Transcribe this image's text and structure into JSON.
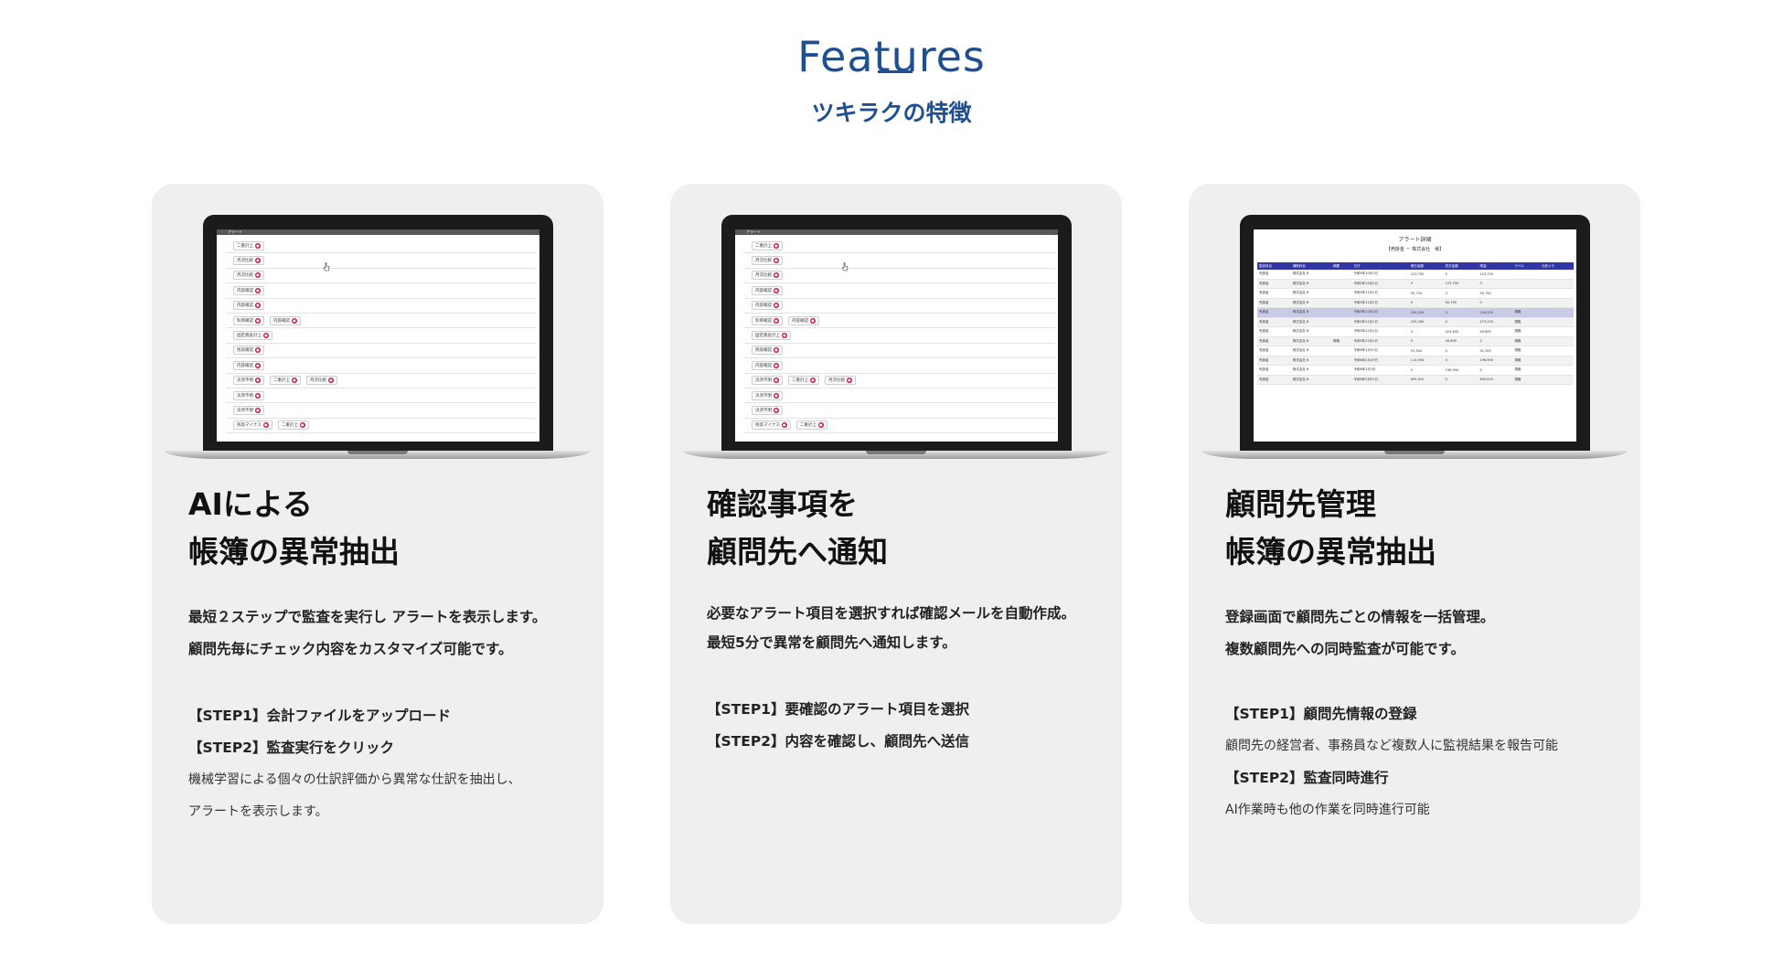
{
  "header": {
    "title": "Features",
    "subtitle": "ツキラクの特徴"
  },
  "cards": [
    {
      "heading_line1": "AIによる",
      "heading_line2": "帳簿の異常抽出",
      "desc_line1": "最短２ステップで監査を実行し アラートを表示します。",
      "desc_line2": "顧問先毎にチェック内容をカスタマイズ可能です。",
      "step1": "【STEP1】会計ファイルをアップロード",
      "step2": "【STEP2】監査実行をクリック",
      "note_line1": "機械学習による個々の仕訳評価から異常な仕訳を抽出し、",
      "note_line2": "アラートを表示します。"
    },
    {
      "heading_line1": "確認事項を",
      "heading_line2": "顧問先へ通知",
      "desc_line1": "必要なアラート項目を選択すれば確認メールを自動作成。",
      "desc_line2": "最短5分で異常を顧問先へ通知します。",
      "step1": "【STEP1】要確認のアラート項目を選択",
      "step2": "【STEP2】内容を確認し、顧問先へ送信"
    },
    {
      "heading_line1": "顧問先管理",
      "heading_line2": "帳簿の異常抽出",
      "desc_line1": "登録画面で顧問先ごとの情報を一括管理。",
      "desc_line2": "複数顧問先への同時監査が可能です。",
      "step1": "【STEP1】顧問先情報の登録",
      "note1": "顧問先の経営者、事務員など複数人に監視結果を報告可能",
      "step2": "【STEP2】監査同時進行",
      "note2": "AI作業時も他の作業を同時進行可能"
    }
  ],
  "screen_alerts": {
    "header_label": "アラート",
    "rows": [
      [
        "二重計上"
      ],
      [
        "月次比較"
      ],
      [
        "月次比較"
      ],
      [
        "内容確認"
      ],
      [
        "内容確認"
      ],
      [
        "科目確認",
        "内容確認"
      ],
      [
        "固定資産計上"
      ],
      [
        "残高確認"
      ],
      [
        "内容確認"
      ],
      [
        "決済不明",
        "二重計上",
        "月次比較"
      ],
      [
        "決済不明"
      ],
      [
        "決済不明"
      ],
      [
        "残高マイナス",
        "二重計上"
      ]
    ]
  },
  "screen_table": {
    "title": "アラート詳細",
    "subtitle": "【売掛金 ー 株式会社　様】",
    "columns": [
      "勘定科目",
      "補助科目",
      "摘要",
      "日付",
      "借方金額",
      "貸方金額",
      "残高",
      "ラベル",
      "仕訳メモ"
    ],
    "rows": [
      [
        "売掛金",
        "株式会社 B",
        "",
        "令和5年10月1日",
        "123,750",
        "0",
        "123,750",
        "",
        ""
      ],
      [
        "売掛金",
        "株式会社 B",
        "",
        "令和5年10月2日",
        "0",
        "123,750",
        "0",
        "",
        ""
      ],
      [
        "売掛金",
        "株式会社 B",
        "",
        "令和5年11月1日",
        "90,750",
        "0",
        "90,750",
        "",
        ""
      ],
      [
        "売掛金",
        "株式会社 B",
        "",
        "令和5年11月2日",
        "0",
        "90,750",
        "0",
        "",
        ""
      ],
      [
        "売掛金",
        "株式会社 B",
        "",
        "令和5年12月1日",
        "194,250",
        "0",
        "194,250",
        "規格",
        ""
      ],
      [
        "売掛金",
        "株式会社 B",
        "",
        "令和5年12月1日",
        "235,260",
        "0",
        "473,250",
        "規格",
        ""
      ],
      [
        "売掛金",
        "株式会社 B",
        "",
        "令和5年12月1日",
        "0",
        "423,600",
        "49,695",
        "規格",
        ""
      ],
      [
        "売掛金",
        "株式会社 B",
        "規格",
        "令和5年12月1日",
        "0",
        "49,695",
        "0",
        "規格",
        ""
      ],
      [
        "売掛金",
        "株式会社 B",
        "",
        "令和6年1月31日",
        "91,300",
        "0",
        "91,300",
        "規格",
        ""
      ],
      [
        "売掛金",
        "株式会社 B",
        "",
        "令和6年2月29日",
        "114,900",
        "0",
        "196,900",
        "規格",
        ""
      ],
      [
        "売掛金",
        "株式会社 B",
        "",
        "令和6年3月1日",
        "0",
        "196,900",
        "0",
        "規格",
        ""
      ],
      [
        "売掛金",
        "株式会社 B",
        "",
        "令和6年3月31日",
        "695,610",
        "0",
        "695,610",
        "規格",
        ""
      ]
    ]
  },
  "colors": {
    "brand": "#1d4f91",
    "card_bg": "#efefef",
    "alert_dot": "#c8184b",
    "table_header": "#3236a4"
  }
}
